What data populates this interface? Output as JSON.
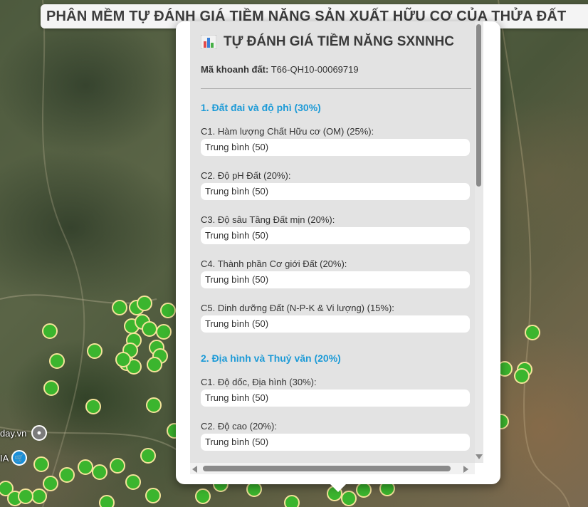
{
  "header": {
    "title": "PHÂN MỀM TỰ ĐÁNH GIÁ TIỀM NĂNG SẢN XUẤT HỮU CƠ CỦA THỬA ĐẤT"
  },
  "map": {
    "place_label": "day.vn",
    "poi_label": "IA",
    "marker_color": "#3bb52e",
    "marker_border_color": "#f3e39a"
  },
  "panel": {
    "title_icon": "bar-chart-icon",
    "title": "TỰ ĐÁNH GIÁ TIỀM NĂNG SXNNHC",
    "parcel_label": "Mã khoanh đất:",
    "parcel_id": "T66-QH10-00069719",
    "sections": [
      {
        "title": "1. Đất đai và độ phì (30%)",
        "criteria": [
          {
            "label": "C1. Hàm lượng Chất Hữu cơ (OM) (25%):",
            "value": "Trung bình (50)"
          },
          {
            "label": "C2. Độ pH Đất (20%):",
            "value": "Trung bình (50)"
          },
          {
            "label": "C3. Độ sâu Tầng Đất mịn (20%):",
            "value": "Trung bình (50)"
          },
          {
            "label": "C4. Thành phần Cơ giới Đất (20%):",
            "value": "Trung bình (50)"
          },
          {
            "label": "C5. Dinh dưỡng Đất (N-P-K & Vi lượng) (15%):",
            "value": "Trung bình (50)"
          }
        ]
      },
      {
        "title": "2. Địa hình và Thuỷ văn (20%)",
        "criteria": [
          {
            "label": "C1. Độ dốc, Địa hình (30%):",
            "value": "Trung bình (50)"
          },
          {
            "label": "C2. Độ cao (20%):",
            "value": "Trung bình (50)"
          }
        ]
      }
    ],
    "section_title_color": "#1e9bd7"
  }
}
